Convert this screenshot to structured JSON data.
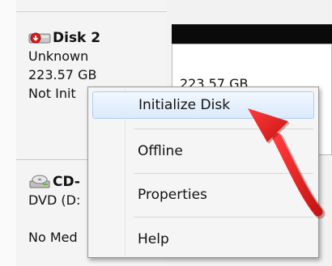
{
  "disk2": {
    "title": "Disk 2",
    "type": "Unknown",
    "size": "223.57 GB",
    "status": "Not Init"
  },
  "volume": {
    "size": "223.57 GB"
  },
  "cdrom": {
    "title": "CD-",
    "type": "DVD (D:",
    "media": "No Med"
  },
  "context_menu": {
    "items": [
      {
        "label": "Initialize Disk"
      },
      {
        "label": "Offline"
      },
      {
        "label": "Properties"
      },
      {
        "label": "Help"
      }
    ]
  },
  "colors": {
    "arrow": "#e01d1d",
    "highlight_border": "#aecff7",
    "volume_bar": "#0a0a0a"
  },
  "icons": {
    "disk": "unknown-disk-icon",
    "cdrom": "cd-drive-icon"
  }
}
